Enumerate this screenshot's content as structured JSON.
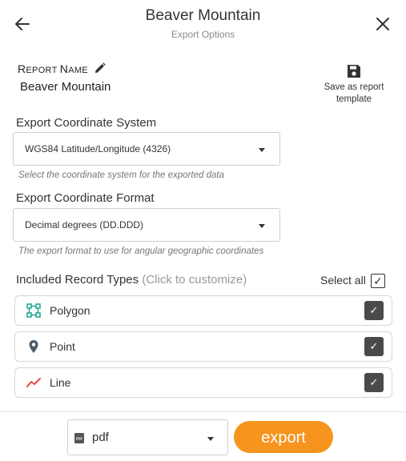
{
  "header": {
    "title": "Beaver Mountain",
    "subtitle": "Export Options"
  },
  "report_name": {
    "label_first": "R",
    "label_rest": "EPORT ",
    "label_first2": "N",
    "label_rest2": "AME",
    "value": "Beaver Mountain"
  },
  "save_template": {
    "line1": "Save as report",
    "line2": "template"
  },
  "coordinate_system": {
    "label": "Export Coordinate System",
    "value": "WGS84 Latitude/Longitude (4326)",
    "hint": "Select the coordinate system for the exported data"
  },
  "coordinate_format": {
    "label": "Export Coordinate Format",
    "value": "Decimal degrees (DD.DDD)",
    "hint": "The export format to use for angular geographic coordinates"
  },
  "record_types": {
    "label": "Included Record Types",
    "label_hint": "(Click to customize)",
    "select_all_label": "Select all",
    "select_all_checked": true,
    "items": [
      {
        "name": "Polygon",
        "icon": "polygon-icon",
        "color": "#1aa390",
        "checked": true
      },
      {
        "name": "Point",
        "icon": "map-pin-icon",
        "color": "#4d5d6b",
        "checked": true
      },
      {
        "name": "Line",
        "icon": "line-icon",
        "color": "#e04848",
        "checked": true
      }
    ]
  },
  "footer": {
    "format_value": "pdf",
    "format_icon_text": "PDF",
    "export_label": "export",
    "accent_color": "#f7941d"
  },
  "checkmark": "✓"
}
